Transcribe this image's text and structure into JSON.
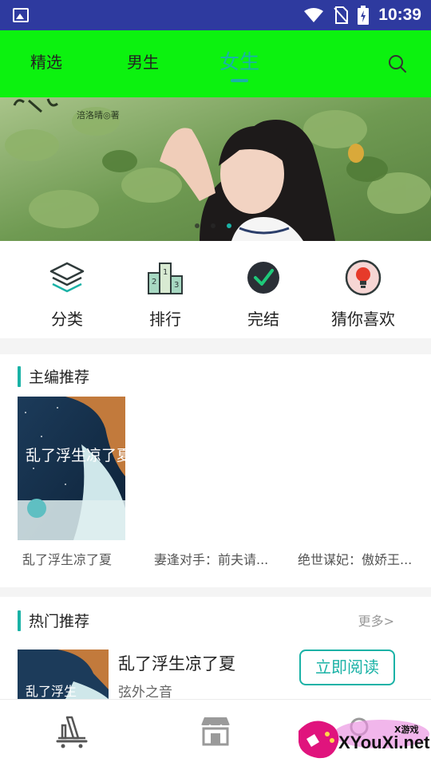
{
  "status_bar": {
    "time": "10:39"
  },
  "top_nav": {
    "tabs": [
      {
        "label": "精选",
        "active": false
      },
      {
        "label": "男生",
        "active": false
      },
      {
        "label": "女生",
        "active": true
      }
    ],
    "search_icon": "search-icon"
  },
  "banner": {
    "overlay_text": "涪洛晴◎著",
    "dots": 3,
    "active_dot": 3
  },
  "categories": [
    {
      "label": "分类",
      "icon": "layers-icon"
    },
    {
      "label": "排行",
      "icon": "podium-icon"
    },
    {
      "label": "完结",
      "icon": "check-circle-icon"
    },
    {
      "label": "猜你喜欢",
      "icon": "lightbulb-icon"
    }
  ],
  "editor_picks": {
    "title": "主编推荐",
    "books": [
      {
        "name": "乱了浮生凉了夏",
        "cover_text": "乱了浮生凉了夏"
      },
      {
        "name": "妻逢对手：前夫请..."
      },
      {
        "name": "绝世谋妃：傲娇王..."
      }
    ]
  },
  "hot": {
    "title": "热门推荐",
    "more": "更多>",
    "items": [
      {
        "title": "乱了浮生凉了夏",
        "author": "弦外之音",
        "button": "立即阅读",
        "cover_text": "乱了浮生"
      }
    ]
  },
  "bottom_bar": {
    "icons": [
      "bookshelf-icon",
      "store-icon",
      "profile-icon"
    ]
  },
  "watermark": {
    "text": "XYouXi.net",
    "small": "X游戏"
  },
  "colors": {
    "accent": "#1ab2a6",
    "nav_bg": "#0cf20f",
    "status_bg": "#2e3a9f"
  }
}
